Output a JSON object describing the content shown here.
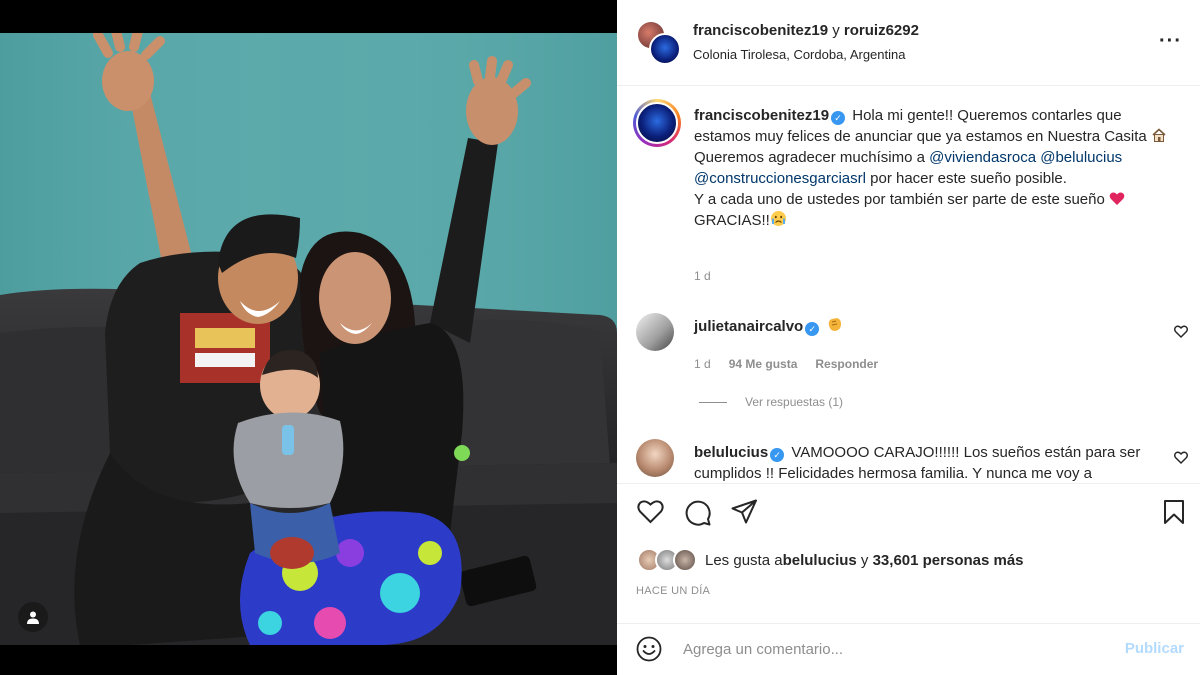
{
  "post": {
    "header": {
      "user_primary": "franciscobenitez19",
      "connector": " y ",
      "user_secondary": "roruiz6292",
      "location": "Colonia Tirolesa, Cordoba, Argentina"
    },
    "caption": {
      "username": "franciscobenitez19",
      "line1": "Hola mi gente!! Queremos contarles que estamos muy felices de anunciar que ya estamos en Nuestra Casita",
      "line2_prefix": "Queremos agradecer muchísimo a ",
      "mention1": "@viviendasroca",
      "mention2": "@belulucius",
      "mention3": "@construccionesgarciasrl",
      "line2_suffix": " por hacer este sueño posible.",
      "line3": "Y a cada uno de ustedes por también ser parte de este sueño",
      "line4": "GRACIAS!!",
      "time": "1 d"
    },
    "comments": [
      {
        "username": "julietanaircalvo",
        "text": "",
        "time": "1 d",
        "likes": "94 Me gusta",
        "reply": "Responder",
        "view_replies": "Ver respuestas (1)"
      },
      {
        "username": "belulucius",
        "text": "VAMOOOO CARAJO!!!!!! Los sueños están para ser cumplidos !! Felicidades hermosa familia. Y nunca me voy a"
      }
    ],
    "likes": {
      "prefix": "Les gusta a ",
      "user": "belulucius",
      "middle": " y ",
      "count": "33,601 personas más"
    },
    "time_ago": "HACE UN DÍA",
    "add_comment": {
      "placeholder": "Agrega un comentario...",
      "publish": "Publicar"
    }
  },
  "colors": {
    "verified": "#3897f0",
    "mention": "#00376b",
    "publish_disabled": "#b3dbff",
    "wall": "#5aa8a8",
    "sofa": "#2e2e30"
  },
  "icons": [
    "more-options-icon",
    "verified-badge-icon",
    "house-emoji-icon",
    "heart-emoji-icon",
    "crying-emoji-icon",
    "clapping-emoji-icon",
    "like-heart-icon",
    "comment-icon",
    "share-icon",
    "bookmark-icon",
    "emoji-icon",
    "user-tag-icon"
  ]
}
